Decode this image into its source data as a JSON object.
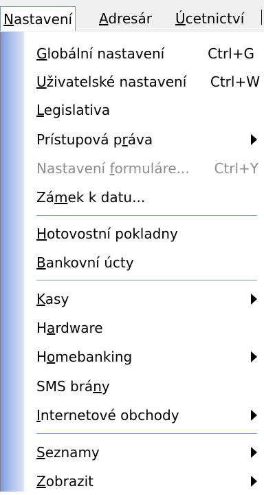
{
  "menubar": {
    "items": [
      {
        "mnemonic": "N",
        "rest": "astavení"
      },
      {
        "mnemonic": "A",
        "rest": "dresár"
      },
      {
        "mnemonic": "Ú",
        "rest": "cetnictví"
      }
    ]
  },
  "menu": {
    "items": [
      {
        "pre": "",
        "mn": "G",
        "post": "lobální nastavení",
        "shortcut": "Ctrl+G"
      },
      {
        "pre": "",
        "mn": "U",
        "post": "živatelské nastavení",
        "shortcut": "Ctrl+W"
      },
      {
        "pre": "",
        "mn": "L",
        "post": "egislativa",
        "shortcut": ""
      },
      {
        "pre": "Prístupová p",
        "mn": "r",
        "post": "áva",
        "shortcut": ""
      },
      {
        "pre": "Nastavení ",
        "mn": "f",
        "post": "ormuláre...",
        "shortcut": "Ctrl+Y"
      },
      {
        "pre": "Zá",
        "mn": "m",
        "post": "ek k datu...",
        "shortcut": ""
      },
      {
        "pre": "",
        "mn": "H",
        "post": "otovostní pokladny",
        "shortcut": ""
      },
      {
        "pre": "",
        "mn": "B",
        "post": "ankovní úcty",
        "shortcut": ""
      },
      {
        "pre": "",
        "mn": "K",
        "post": "asy",
        "shortcut": ""
      },
      {
        "pre": "H",
        "mn": "a",
        "post": "rdware",
        "shortcut": ""
      },
      {
        "pre": "H",
        "mn": "o",
        "post": "mebanking",
        "shortcut": ""
      },
      {
        "pre": "SMS brá",
        "mn": "n",
        "post": "y",
        "shortcut": ""
      },
      {
        "pre": "",
        "mn": "I",
        "post": "nternetové obchody",
        "shortcut": ""
      },
      {
        "pre": "",
        "mn": "S",
        "post": "eznamy",
        "shortcut": ""
      },
      {
        "pre": "",
        "mn": "Z",
        "post": "obrazit",
        "shortcut": ""
      }
    ]
  },
  "colors": {
    "gutter": "#7e9be0",
    "separator": "#7f9db9",
    "disabled_text": "#8d8d8d"
  },
  "icons": {
    "submenu": "submenu-arrow-icon"
  }
}
